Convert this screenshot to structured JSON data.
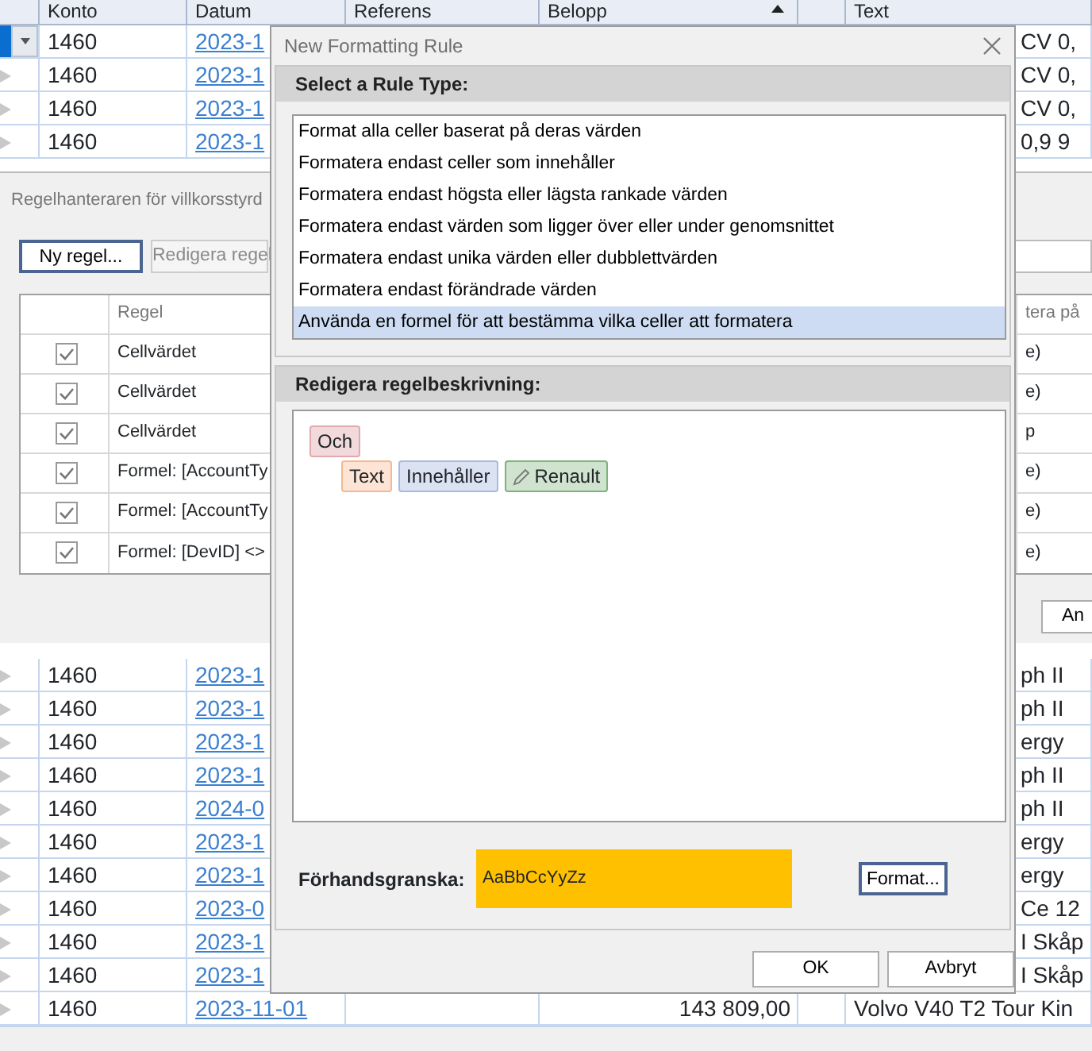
{
  "grid": {
    "columns": [
      {
        "label": "Konto"
      },
      {
        "label": "Datum"
      },
      {
        "label": "Referens"
      },
      {
        "label": "Belopp",
        "sorted": true
      },
      {
        "label": "Text"
      }
    ],
    "rows_above": [
      {
        "konto": "1460",
        "datum": "2023-1",
        "text": "CV 0,",
        "selected": true
      },
      {
        "konto": "1460",
        "datum": "2023-1",
        "text": "CV 0,",
        "selected": false
      },
      {
        "konto": "1460",
        "datum": "2023-1",
        "text": "CV 0,",
        "selected": false
      },
      {
        "konto": "1460",
        "datum": "2023-1",
        "text": "0,9 9",
        "selected": false
      }
    ],
    "rows_below": [
      {
        "konto": "1460",
        "datum": "2023-1",
        "text": "ph II",
        "selected": false
      },
      {
        "konto": "1460",
        "datum": "2023-1",
        "text": "ph II",
        "selected": false
      },
      {
        "konto": "1460",
        "datum": "2023-1",
        "text": "ergy",
        "selected": false
      },
      {
        "konto": "1460",
        "datum": "2023-1",
        "text": "ph II",
        "selected": false
      },
      {
        "konto": "1460",
        "datum": "2024-0",
        "text": "ph II",
        "selected": false
      },
      {
        "konto": "1460",
        "datum": "2023-1",
        "text": "ergy",
        "selected": false
      },
      {
        "konto": "1460",
        "datum": "2023-1",
        "text": "ergy",
        "selected": false
      },
      {
        "konto": "1460",
        "datum": "2023-0",
        "text": "Ce 12",
        "selected": false
      },
      {
        "konto": "1460",
        "datum": "2023-1",
        "text": "I Skåp",
        "selected": false
      },
      {
        "konto": "1460",
        "datum": "2023-1",
        "text": "I Skåp",
        "selected": false
      },
      {
        "konto": "1460",
        "datum": "2023-11-01",
        "amount": "143 809,00",
        "text": "Volvo V40 T2 Tour Kin",
        "selected": false
      }
    ]
  },
  "rule_manager": {
    "title": "Regelhanteraren för villkorsstyrd",
    "buttons": [
      {
        "label": "Ny regel...",
        "disabled": false
      },
      {
        "label": "Redigera regel",
        "disabled": true
      }
    ],
    "table": {
      "column": "Regel",
      "column_cut": "tera på",
      "rules": [
        {
          "checked": true,
          "text": "Cellvärdet",
          "tail": "e)"
        },
        {
          "checked": true,
          "text": "Cellvärdet",
          "tail": "e)"
        },
        {
          "checked": true,
          "text": "Cellvärdet",
          "tail": "p"
        },
        {
          "checked": true,
          "text": "Formel: [AccountTy",
          "tail": "e)"
        },
        {
          "checked": true,
          "text": "Formel: [AccountTy",
          "tail": "e)"
        },
        {
          "checked": true,
          "text": "Formel: [DevID] <>",
          "tail": "e)"
        }
      ]
    },
    "apply_button": "An"
  },
  "dialog": {
    "title": "New Formatting Rule",
    "rule_type_header": "Select a Rule Type:",
    "rule_types": [
      {
        "label": "Format alla celler baserat på deras värden",
        "selected": false
      },
      {
        "label": "Formatera endast celler som innehåller",
        "selected": false
      },
      {
        "label": "Formatera endast högsta eller lägsta rankade värden",
        "selected": false
      },
      {
        "label": "Formatera endast värden som ligger över eller under genomsnittet",
        "selected": false
      },
      {
        "label": "Formatera endast unika värden eller dubblettvärden",
        "selected": false
      },
      {
        "label": "Formatera endast förändrade värden",
        "selected": false
      },
      {
        "label": "Använda en formel för att bestämma vilka celler att formatera",
        "selected": true
      }
    ],
    "description_header": "Redigera regelbeskrivning:",
    "description": {
      "kind": "group",
      "text": "Och",
      "children": [
        {
          "kind": "field",
          "text": "Text"
        },
        {
          "kind": "operator",
          "text": "Innehåller"
        },
        {
          "kind": "value",
          "text": "Renault"
        }
      ]
    },
    "preview": {
      "label": "Förhandsgranska:",
      "sample": "AaBbCcYyZz",
      "format_button": "Format..."
    },
    "buttons": [
      "OK",
      "Avbryt"
    ]
  }
}
